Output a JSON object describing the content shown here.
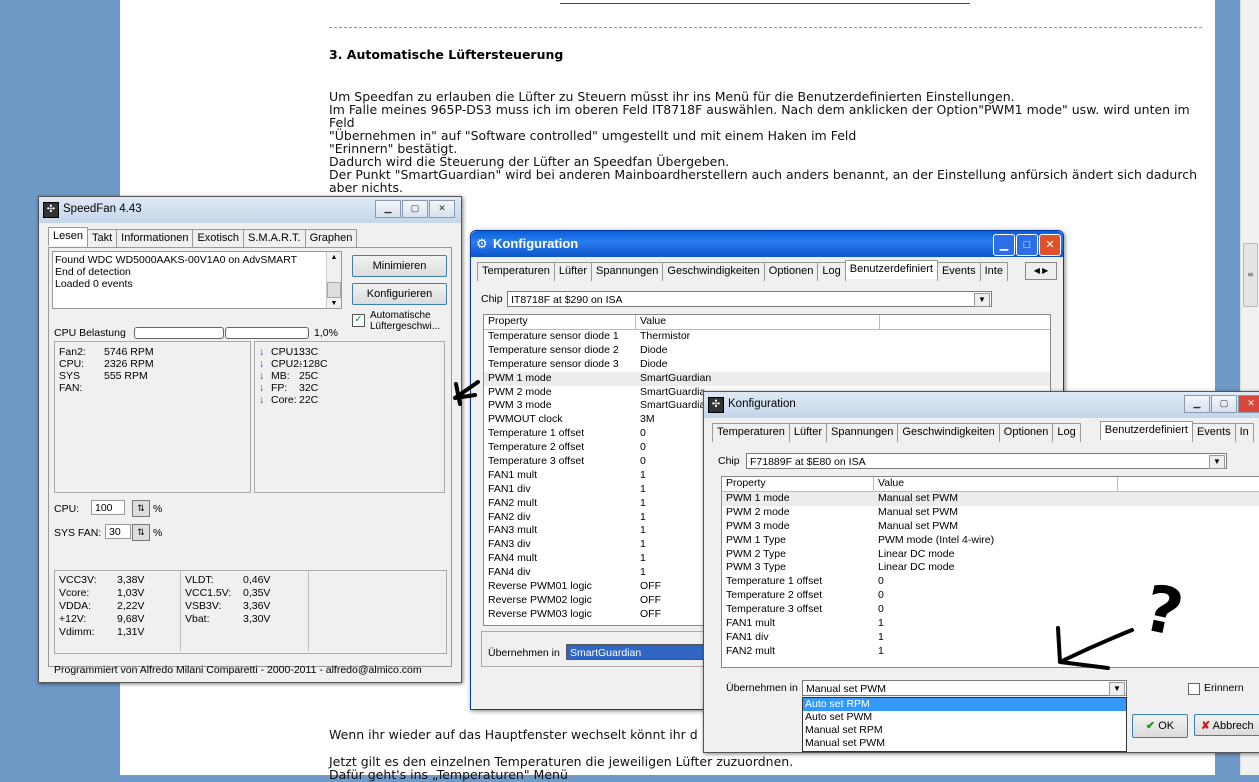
{
  "article": {
    "heading": "3. Automatische Lüftersteuerung",
    "paragraph": "Um Speedfan zu erlauben die Lüfter zu Steuern müsst ihr ins Menü für die Benutzerdefinierten Einstellungen.\nIm Falle meines 965P-DS3 muss ich im oberen Feld IT8718F auswählen. Nach dem anklicken der Option\"PWM1 mode\" usw. wird unten im Feld\n\"Übernehmen in\" auf \"Software controlled\" umgestellt und mit einem Haken im Feld\n\"Erinnern\" bestätigt.\nDadurch wird die Steuerung der Lüfter an Speedfan Übergeben.\nDer Punkt \"SmartGuardian\" wird bei anderen Mainboardherstellern auch anders benannt, an der Einstellung anfürsich ändert sich dadurch aber nichts.",
    "bottom1": "Wenn ihr wieder auf das Hauptfenster wechselt könnt ihr d",
    "bottom2": "Jetzt gilt es den einzelnen Temperaturen die jeweiligen Lüfter zuzuordnen.",
    "bottom3": "Dafür geht's ins „Temperaturen\" Menü"
  },
  "speedfan": {
    "title": "SpeedFan 4.43",
    "tabs": [
      "Lesen",
      "Takt",
      "Informationen",
      "Exotisch",
      "S.M.A.R.T.",
      "Graphen"
    ],
    "log": [
      "Found WDC WD5000AAKS-00V1A0 on AdvSMART",
      "End of detection",
      "Loaded 0 events"
    ],
    "btn_minimize": "Minimieren",
    "btn_configure": "Konfigurieren",
    "auto_fan_label": "Automatische Lüftergeschwi...",
    "cpu_load_label": "CPU Belastung",
    "cpu_load_value": "1,0%",
    "fans": [
      {
        "name": "Fan2:",
        "value": "5746 RPM"
      },
      {
        "name": "CPU:",
        "value": "2326 RPM"
      },
      {
        "name": "SYS FAN:",
        "value": "555 RPM"
      }
    ],
    "temps": [
      {
        "name": "CPU1:",
        "value": "33C"
      },
      {
        "name": "CPU2:",
        "value": "-128C"
      },
      {
        "name": "MB:",
        "value": "25C"
      },
      {
        "name": "FP:",
        "value": "32C"
      },
      {
        "name": "Core:",
        "value": "22C"
      }
    ],
    "cpu_speed_label": "CPU:",
    "cpu_speed_value": "100",
    "sysfan_speed_label": "SYS FAN:",
    "sysfan_speed_value": "30",
    "percent": "%",
    "volts_left": [
      {
        "name": "VCC3V:",
        "value": "3,38V"
      },
      {
        "name": "Vcore:",
        "value": "1,03V"
      },
      {
        "name": "VDDA:",
        "value": "2,22V"
      },
      {
        "name": "+12V:",
        "value": "9,68V"
      },
      {
        "name": "Vdimm:",
        "value": "1,31V"
      }
    ],
    "volts_right": [
      {
        "name": "VLDT:",
        "value": "0,46V"
      },
      {
        "name": "VCC1.5V:",
        "value": "0,35V"
      },
      {
        "name": "VSB3V:",
        "value": "3,36V"
      },
      {
        "name": "Vbat:",
        "value": "3,30V"
      }
    ],
    "footer": "Programmiert von Alfredo Milani Comparetti - 2000-2011 - alfredo@almico.com"
  },
  "config1": {
    "title": "Konfiguration",
    "tabs": [
      "Temperaturen",
      "Lüfter",
      "Spannungen",
      "Geschwindigkeiten",
      "Optionen",
      "Log",
      "Benutzerdefiniert",
      "Events",
      "Inte"
    ],
    "chip_label": "Chip",
    "chip_value": "IT8718F at $290 on ISA",
    "col_property": "Property",
    "col_value": "Value",
    "rows": [
      [
        "Temperature sensor diode 1",
        "Thermistor"
      ],
      [
        "Temperature sensor diode 2",
        "Diode"
      ],
      [
        "Temperature sensor diode 3",
        "Diode"
      ],
      [
        "PWM 1 mode",
        "SmartGuardian"
      ],
      [
        "PWM 2 mode",
        "SmartGuardia"
      ],
      [
        "PWM 3 mode",
        "SmartGuardia"
      ],
      [
        "PWMOUT clock",
        "3M"
      ],
      [
        "Temperature 1 offset",
        "0"
      ],
      [
        "Temperature 2 offset",
        "0"
      ],
      [
        "Temperature 3 offset",
        "0"
      ],
      [
        "FAN1 mult",
        "1"
      ],
      [
        "FAN1 div",
        "1"
      ],
      [
        "FAN2 mult",
        "1"
      ],
      [
        "FAN2 div",
        "1"
      ],
      [
        "FAN3 mult",
        "1"
      ],
      [
        "FAN3 div",
        "1"
      ],
      [
        "FAN4 mult",
        "1"
      ],
      [
        "FAN4 div",
        "1"
      ],
      [
        "Reverse PWM01 logic",
        "OFF"
      ],
      [
        "Reverse PWM02 logic",
        "OFF"
      ],
      [
        "Reverse PWM03 logic",
        "OFF"
      ]
    ],
    "apply_label": "Übernehmen in",
    "apply_value": "SmartGuardian"
  },
  "config2": {
    "title": "Konfiguration",
    "tabs": [
      "Temperaturen",
      "Lüfter",
      "Spannungen",
      "Geschwindigkeiten",
      "Optionen",
      "Log",
      "Benutzerdefiniert",
      "Events",
      "In"
    ],
    "chip_label": "Chip",
    "chip_value": "F71889F at $E80 on ISA",
    "col_property": "Property",
    "col_value": "Value",
    "rows": [
      [
        "PWM 1 mode",
        "Manual set PWM"
      ],
      [
        "PWM 2 mode",
        "Manual set PWM"
      ],
      [
        "PWM 3 mode",
        "Manual set PWM"
      ],
      [
        "PWM 1 Type",
        "PWM mode (Intel 4-wire)"
      ],
      [
        "PWM 2 Type",
        "Linear DC mode"
      ],
      [
        "PWM 3 Type",
        "Linear DC mode"
      ],
      [
        "Temperature 1 offset",
        "0"
      ],
      [
        "Temperature 2 offset",
        "0"
      ],
      [
        "Temperature 3 offset",
        "0"
      ],
      [
        "FAN1 mult",
        "1"
      ],
      [
        "FAN1 div",
        "1"
      ],
      [
        "FAN2 mult",
        "1"
      ]
    ],
    "apply_label": "Übernehmen in",
    "apply_value": "Manual set PWM",
    "remember_label": "Erinnern",
    "options": [
      "Auto set RPM",
      "Auto set PWM",
      "Manual set RPM",
      "Manual set PWM"
    ],
    "ok_label": "OK",
    "cancel_label": "Abbrech"
  },
  "annotation": {
    "question": "?"
  }
}
